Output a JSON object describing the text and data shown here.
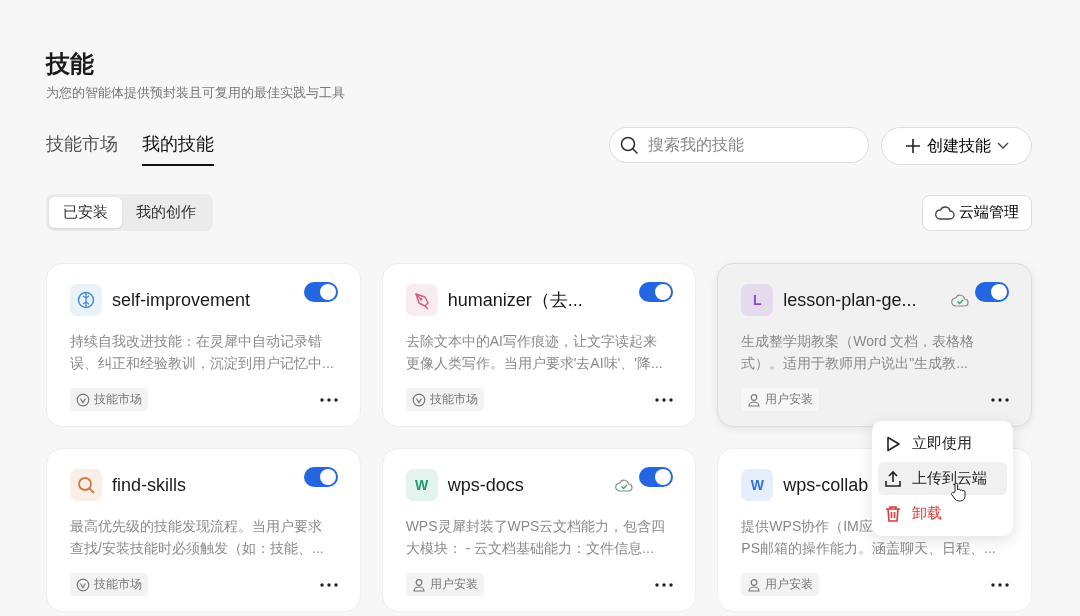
{
  "header": {
    "title": "技能",
    "subtitle": "为您的智能体提供预封装且可复用的最佳实践与工具"
  },
  "tabs": [
    {
      "label": "技能市场",
      "selected": false
    },
    {
      "label": "我的技能",
      "selected": true
    }
  ],
  "search": {
    "placeholder": "搜索我的技能"
  },
  "create_button": {
    "label": "创建技能"
  },
  "filters": [
    {
      "label": "已安装",
      "selected": true
    },
    {
      "label": "我的创作",
      "selected": false
    }
  ],
  "cloud_button": {
    "label": "云端管理"
  },
  "cards": [
    {
      "name": "self-improvement",
      "icon": {
        "kind": "brain",
        "color": "#4a8fd0"
      },
      "description_lines": [
        "持续自我改进技能：在灵犀中自动记录错",
        "误、纠正和经验教训，沉淀到用户记忆中..."
      ],
      "source": {
        "kind": "market",
        "label": "技能市场"
      },
      "enabled": true,
      "cloud_synced": false,
      "hovered": false
    },
    {
      "name": "humanizer（去...",
      "icon": {
        "kind": "pen",
        "color": "#d0607e"
      },
      "description_lines": [
        "去除文本中的AI写作痕迹，让文字读起来",
        "更像人类写作。当用户要求'去AI味'、'降..."
      ],
      "source": {
        "kind": "market",
        "label": "技能市场"
      },
      "enabled": true,
      "cloud_synced": false,
      "hovered": false
    },
    {
      "name": "lesson-plan-ge...",
      "icon": {
        "kind": "letter",
        "letter": "L",
        "color": "#8a4ae0"
      },
      "description_lines": [
        "生成整学期教案（Word 文档，表格格",
        "式）。适用于教师用户说出\"生成教..."
      ],
      "source": {
        "kind": "user",
        "label": "用户安装"
      },
      "enabled": true,
      "cloud_synced": true,
      "hovered": true
    },
    {
      "name": "find-skills",
      "icon": {
        "kind": "search",
        "color": "#d07a3e"
      },
      "description_lines": [
        "最高优先级的技能发现流程。当用户要求",
        "查找/安装技能时必须触发（如：技能、..."
      ],
      "source": {
        "kind": "market",
        "label": "技能市场"
      },
      "enabled": true,
      "cloud_synced": false,
      "hovered": false
    },
    {
      "name": "wps-docs",
      "icon": {
        "kind": "letter",
        "letter": "W",
        "color": "#1a9a6e"
      },
      "description_lines": [
        "WPS灵犀封装了WPS云文档能力，包含四",
        "大模块： - 云文档基础能力：文件信息..."
      ],
      "source": {
        "kind": "user",
        "label": "用户安装"
      },
      "enabled": true,
      "cloud_synced": true,
      "hovered": false
    },
    {
      "name": "wps-collab",
      "icon": {
        "kind": "letter",
        "letter": "W",
        "color": "#2f6fe0"
      },
      "description_lines": [
        "提供WPS协作（IM应",
        "PS邮箱的操作能力。涵盖聊天、日程、..."
      ],
      "source": {
        "kind": "user",
        "label": "用户安装"
      },
      "cloud_synced": false,
      "hovered": false
    }
  ],
  "context_menu": {
    "items": [
      {
        "kind": "play",
        "label": "立即使用",
        "hovered": false
      },
      {
        "kind": "upload",
        "label": "上传到云端",
        "hovered": true
      },
      {
        "kind": "delete",
        "label": "卸载",
        "hovered": false
      }
    ]
  }
}
